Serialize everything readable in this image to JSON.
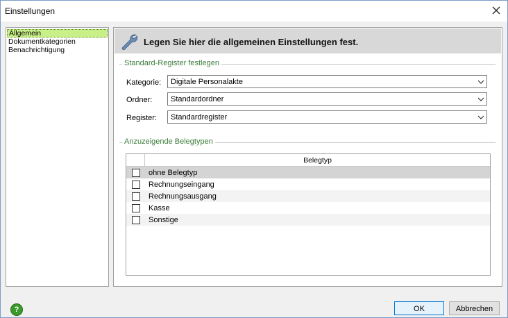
{
  "window": {
    "title": "Einstellungen"
  },
  "nav": {
    "items": [
      "Allgemein",
      "Dokumentkategorien",
      "Benachrichtigung"
    ],
    "selected": "Allgemein"
  },
  "panel": {
    "header": "Legen Sie hier die allgemeinen Einstellungen fest."
  },
  "standard_register": {
    "group_title": "Standard-Register festlegen",
    "kategorie_label": "Kategorie:",
    "kategorie_value": "Digitale Personalakte",
    "ordner_label": "Ordner:",
    "ordner_value": "Standardordner",
    "register_label": "Register:",
    "register_value": "Standardregister"
  },
  "belegtypen": {
    "group_title": "Anzuzeigende Belegtypen",
    "column_header": "Belegtyp",
    "rows": [
      {
        "label": "ohne Belegtyp",
        "checked": false
      },
      {
        "label": "Rechnungseingang",
        "checked": false
      },
      {
        "label": "Rechnungsausgang",
        "checked": false
      },
      {
        "label": "Kasse",
        "checked": false
      },
      {
        "label": "Sonstige",
        "checked": false
      }
    ]
  },
  "buttons": {
    "ok": "OK",
    "cancel": "Abbrechen"
  },
  "icons": {
    "close": "close-icon",
    "header": "wrench-icon",
    "help": "help-icon",
    "dropdown": "chevron-down-icon"
  },
  "colors": {
    "nav_selected": "#c9f088",
    "group_title": "#3a7b3a",
    "help": "#3a9a2a",
    "header_bg": "#d8d8d8"
  }
}
